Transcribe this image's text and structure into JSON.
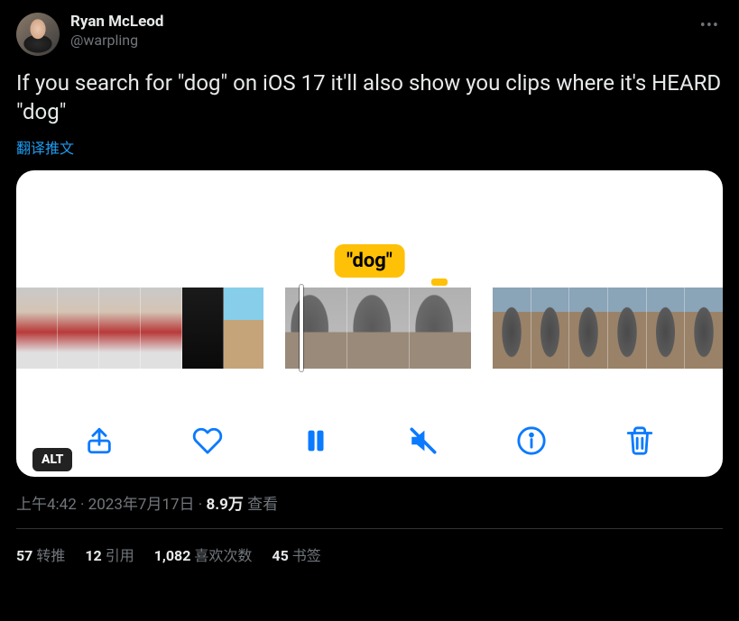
{
  "author": {
    "display_name": "Ryan McLeod",
    "handle": "@warpling"
  },
  "body": "If you search for \"dog\" on iOS 17 it'll also show you clips where it's HEARD \"dog\"",
  "translate_label": "翻译推文",
  "media": {
    "highlight_label": "\"dog\"",
    "alt_badge": "ALT"
  },
  "meta": {
    "time": "上午4:42",
    "date": "2023年7月17日",
    "views_num": "8.9万",
    "views_label": "查看"
  },
  "stats": {
    "retweets_num": "57",
    "retweets_label": "转推",
    "quotes_num": "12",
    "quotes_label": "引用",
    "likes_num": "1,082",
    "likes_label": "喜欢次数",
    "bookmarks_num": "45",
    "bookmarks_label": "书签"
  }
}
